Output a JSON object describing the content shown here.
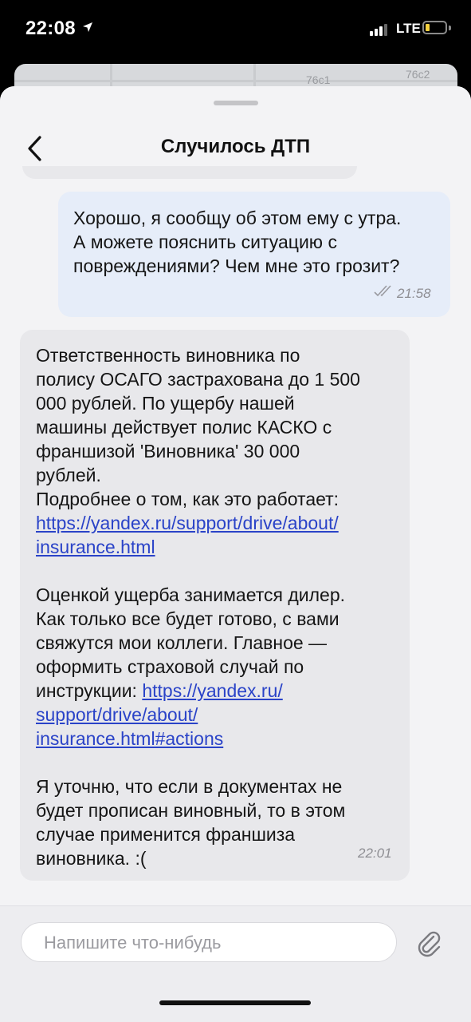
{
  "status_bar": {
    "time": "22:08",
    "network": "LTE",
    "location_icon": "location-arrow-icon",
    "battery_level": 0.15
  },
  "map": {
    "labels": [
      "76c1",
      "76c2"
    ]
  },
  "header": {
    "title": "Случилось ДТП",
    "back_icon": "chevron-left-icon"
  },
  "messages": {
    "outgoing": {
      "lines": [
        "Хорошо, я сообщу об этом ему с утра.",
        "А можете пояснить ситуацию с",
        "повреждениями? Чем мне это грозит?"
      ],
      "time": "21:58",
      "status_icon": "double-check-icon"
    },
    "incoming": {
      "p1": [
        "Ответственность виновника по",
        "полису ОСАГО застрахована до 1 500",
        "000 рублей. По ущербу нашей",
        "машины действует полис КАСКО с",
        "франшизой 'Виновника' 30 000",
        "рублей.",
        "Подробнее о том, как это работает:"
      ],
      "link1": [
        "https://yandex.ru/support/drive/about/",
        "insurance.html"
      ],
      "p2": [
        "Оценкой ущерба занимается дилер.",
        "Как только все будет готово, с вами",
        "свяжутся мои коллеги. Главное —",
        "оформить страховой случай по"
      ],
      "p2_tail_text": "инструкции: ",
      "link2": [
        "https://yandex.ru/",
        "support/drive/about/",
        "insurance.html#actions"
      ],
      "p3": [
        "Я уточню, что если в документах не",
        "будет прописан виновный, то в этом",
        "случае применится франшиза",
        "виновника. :("
      ],
      "time": "22:01"
    }
  },
  "composer": {
    "placeholder": "Напишите что-нибудь",
    "attach_icon": "paperclip-icon"
  }
}
